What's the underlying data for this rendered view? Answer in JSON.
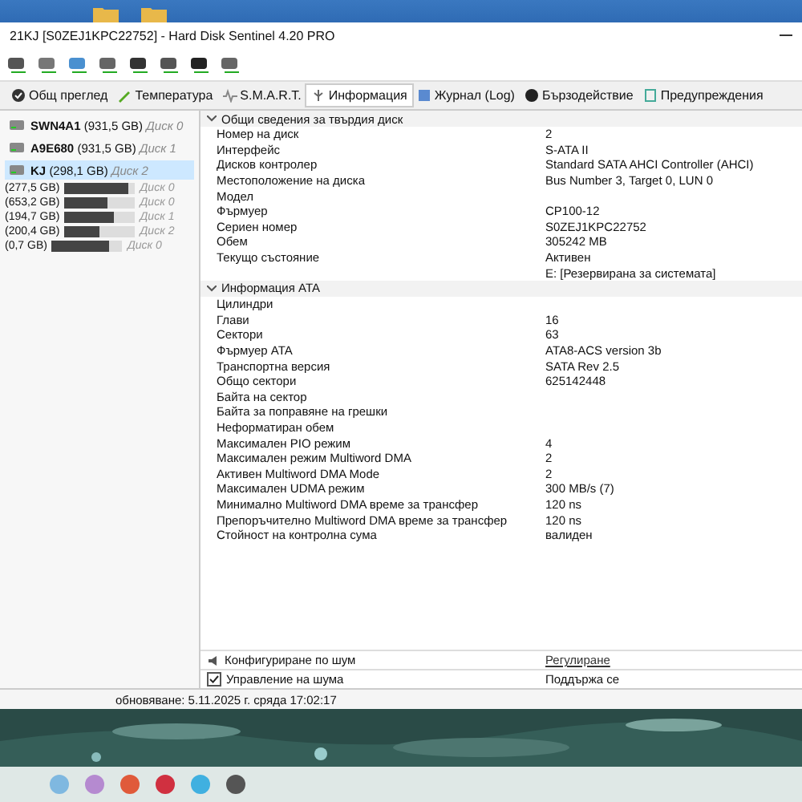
{
  "window": {
    "title": "21KJ [S0ZEJ1KPC22752]  -  Hard Disk Sentinel 4.20 PRO"
  },
  "tabs": [
    {
      "label": "Общ преглед",
      "selected": false
    },
    {
      "label": "Температура",
      "selected": false
    },
    {
      "label": "S.M.A.R.T.",
      "selected": false
    },
    {
      "label": "Информация",
      "selected": true
    },
    {
      "label": "Журнал (Log)",
      "selected": false
    },
    {
      "label": "Бързодействие",
      "selected": false
    },
    {
      "label": "Предупреждения",
      "selected": false
    }
  ],
  "disks": [
    {
      "model": "SWN4A1",
      "size": "(931,5 GB)",
      "disk": "Диск 0",
      "selected": false
    },
    {
      "model": "A9E680",
      "size": "(931,5 GB)",
      "disk": "Диск 1",
      "selected": false
    },
    {
      "model": "KJ",
      "size": "(298,1 GB)",
      "disk": "Диск 2",
      "selected": true
    }
  ],
  "volumes": [
    {
      "size": "(277,5 GB)",
      "disk": "Диск 0",
      "level": 0.9
    },
    {
      "size": "(653,2 GB)",
      "disk": "Диск 0",
      "level": 0.6
    },
    {
      "size": "(194,7 GB)",
      "disk": "Диск 1",
      "level": 0.7
    },
    {
      "size": "(200,4 GB)",
      "disk": "Диск 2",
      "level": 0.5
    },
    {
      "size": "(0,7 GB)",
      "disk": "Диск 0",
      "level": 0.8
    }
  ],
  "sections": [
    {
      "title": "Общи сведения за твърдия диск",
      "rows": [
        {
          "label": "Номер на диск",
          "value": "2"
        },
        {
          "label": "Интерфейс",
          "value": "S-ATA II"
        },
        {
          "label": "Дисков контролер",
          "value": "Standard SATA AHCI Controller (AHCI)"
        },
        {
          "label": "Местоположение на диска",
          "value": "Bus Number 3, Target 0, LUN 0"
        },
        {
          "label": "Модел"
        },
        {
          "label": "Фърмуер",
          "value": "CP100-12"
        },
        {
          "label": "Сериен номер",
          "value": "S0ZEJ1KPC22752"
        },
        {
          "label": "Обем",
          "value": "305242 MB"
        },
        {
          "label": "Текущо състояние",
          "value": "Активен"
        }
      ]
    },
    {
      "rows": [
        {
          "label": "",
          "value": "E: [Резервирана за системата]"
        }
      ]
    },
    {
      "title": "Информация ATA",
      "rows": [
        {
          "label": "Цилиндри"
        },
        {
          "label": "Глави",
          "value": "16"
        },
        {
          "label": "Сектори",
          "value": "63"
        },
        {
          "label": "Фърмуер ATA",
          "value": "ATA8-ACS version 3b"
        },
        {
          "label": "Транспортна версия",
          "value": "SATA Rev 2.5"
        },
        {
          "label": "Общо сектори",
          "value": "625142448"
        },
        {
          "label": "Байта на сектор"
        },
        {
          "label": "Байта за поправяне на грешки"
        },
        {
          "label": "Неформатиран обем"
        },
        {
          "label": "Максимален PIO режим",
          "value": "4"
        },
        {
          "label": "Максимален режим Multiword DMA",
          "value": "2"
        },
        {
          "label": "Активен Multiword DMA Mode",
          "value": "2"
        },
        {
          "label": "Максимален UDMA режим",
          "value": "300 MB/s (7)"
        },
        {
          "label": "Минимално Multiword DMA време за трансфер",
          "value": "120 ns"
        },
        {
          "label": "Препоръчително Multiword DMA време за трансфер",
          "value": "120 ns"
        },
        {
          "label": "Стойност на контролна сума",
          "value": "валиден"
        }
      ]
    }
  ],
  "features": [
    {
      "kind": "link",
      "label": "Конфигуриране по шум",
      "value": "Регулиране"
    },
    {
      "kind": "checkbox",
      "label": "Управление на шума",
      "value": "Поддържа се",
      "checked": true
    }
  ],
  "status_bar": "обновяване: 5.11.2025 г. сряда 17:02:17"
}
